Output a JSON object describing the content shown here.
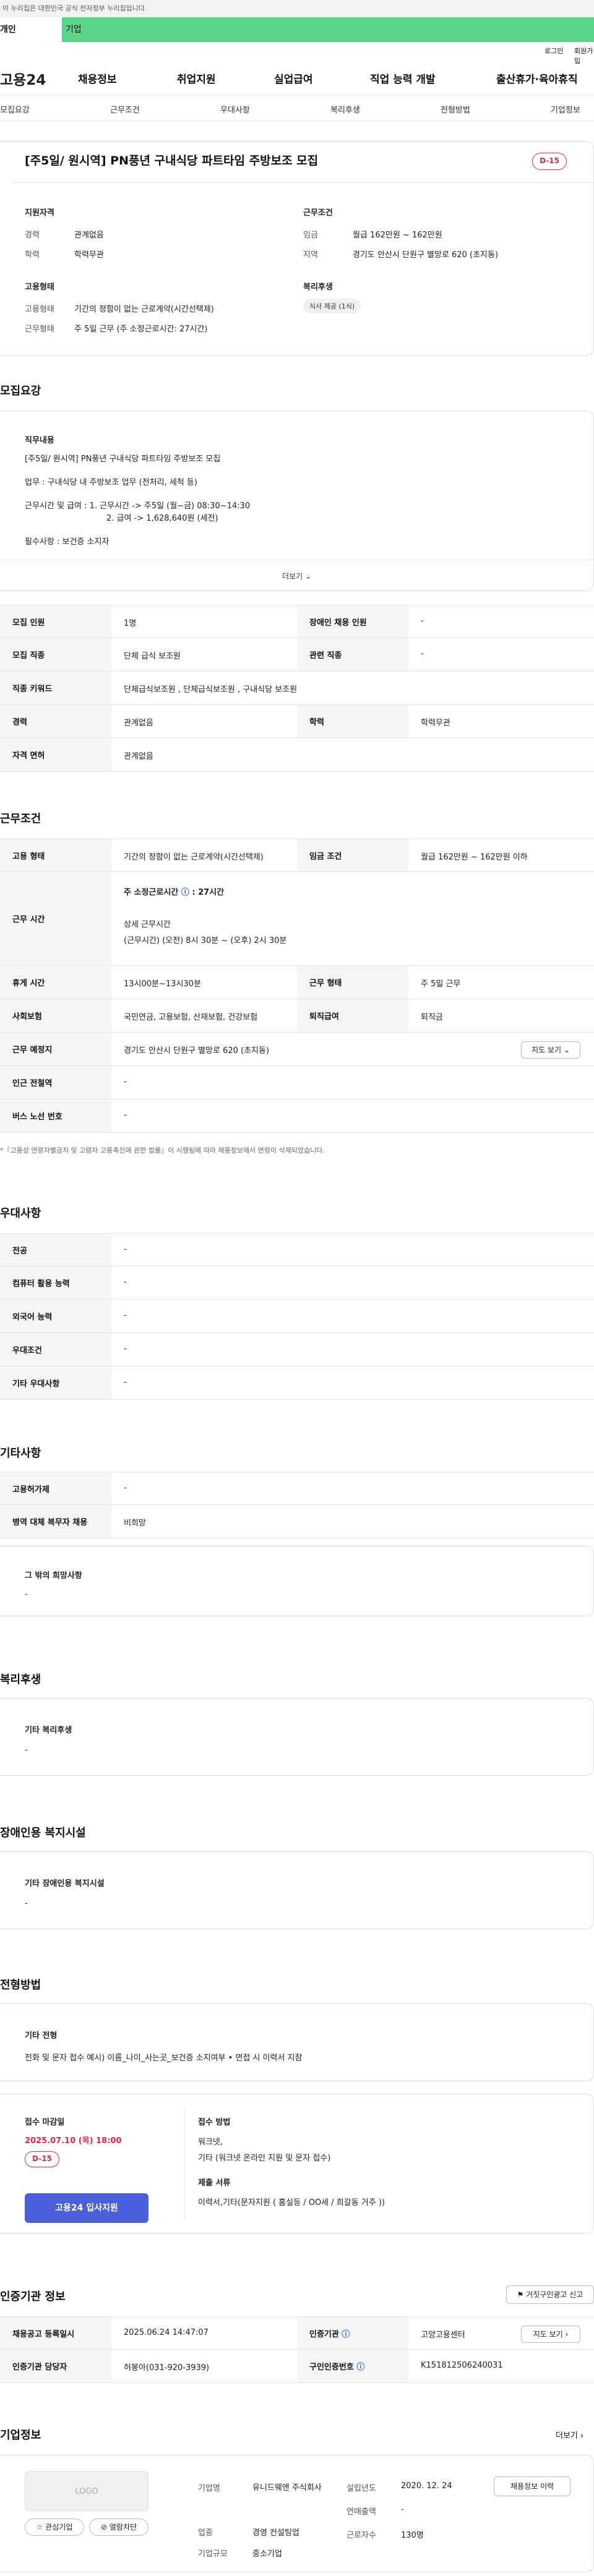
{
  "gov_banner": "이 누리집은 대한민국 공식 전자정부 누리집입니다.",
  "audience": {
    "personal": "개인",
    "company": "기업"
  },
  "util": {
    "login": "로그인",
    "join": "회원가입"
  },
  "logo": "고용24",
  "gnb": [
    "채용정보",
    "취업지원",
    "실업급여",
    "직업 능력 개발",
    "출산휴가·육아휴직"
  ],
  "subnav": [
    "모집요강",
    "근무조건",
    "우대사항",
    "복리후생",
    "전형방법",
    "기업정보"
  ],
  "job": {
    "title": "[주5일/ 원시역] PN풍년 구내식당 파트타임 주방보조 모집",
    "dday": "D-15"
  },
  "summary": {
    "qual_h": "지원자격",
    "exp_l": "경력",
    "exp_v": "관계없음",
    "edu_l": "학력",
    "edu_v": "학력무관",
    "cond_h": "근무조건",
    "wage_l": "임금",
    "wage_v": "월급 162만원 ~ 162만원",
    "loc_l": "지역",
    "loc_v": "경기도 안산시 단원구 별망로 620 (초지동)",
    "emp_h": "고용형태",
    "type_l": "고용형태",
    "type_v": "기간의 정함이 없는 근로계약(시간선택제)",
    "work_l": "근무형태",
    "work_v": "주 5일 근무 (주 소정근로시간: 27시간)",
    "wel_h": "복리후생",
    "wel_chip": "식사 제공 (1식)"
  },
  "recruit": {
    "h": "모집요강",
    "desc_h": "직무내용",
    "lines": [
      "[주5일/ 원시역] PN풍년 구내식당 파트타임 주방보조 모집",
      "업무 : 구내식당 내 주방보조 업무 (전처리, 세척 등)",
      "근무시간 및 급여 :   1. 근무시간 -> 주5일 (월~금) 08:30~14:30",
      "2. 급여 -> 1,628,640원 (세전)",
      "필수사항 : 보건증 소지자"
    ],
    "more": "더보기",
    "rows": [
      {
        "a": "모집 인원",
        "b": "1명",
        "c": "장애인 채용 인원",
        "d": "-"
      },
      {
        "a": "모집 직종",
        "b": "단체 급식 보조원",
        "c": "관련 직종",
        "d": "-"
      },
      {
        "a": "직종 키워드",
        "b": "단체급식보조원 , 단체급식보조원 , 구내식당 보조원"
      },
      {
        "a": "경력",
        "b": "관계없음",
        "c": "학력",
        "d": "학력무관"
      },
      {
        "a": "자격 면허",
        "b": "관계없음"
      }
    ]
  },
  "cond": {
    "h": "근무조건",
    "type_a": "고용 형태",
    "type_b": "기간의 정함이 없는 근로계약(시간선택제)",
    "wage_a": "임금 조건",
    "wage_b": "월급 162만원 ~ 162만원 이하",
    "time_a": "근무 시간",
    "time_week": "주 소정근로시간",
    "time_week_v": "27시간",
    "time_detail_h": "상세 근무시간",
    "time_detail_v": "(근무시간) (오전) 8시 30분 ~ (오후) 2시 30분",
    "rest_a": "휴게 시간",
    "rest_b": "13시00분~13시30분",
    "form_a": "근무 형태",
    "form_b": "주 5일 근무",
    "ins_a": "사회보험",
    "ins_b": "국민연금, 고용보험, 산재보험, 건강보험",
    "ret_a": "퇴직급여",
    "ret_b": "퇴직금",
    "place_a": "근무 예정지",
    "place_b": "경기도 안산시 단원구 별망로 620 (초지동)",
    "map_btn": "지도 보기",
    "sub_a": "인근 전철역",
    "sub_b": "-",
    "bus_a": "버스 노선 번호",
    "bus_b": "-",
    "note": "*『고용상 연령차별금지 및 고령자 고용촉진에 관한 법률』이 시행됨에 따라 채용정보에서 연령이 삭제되었습니다."
  },
  "pref": {
    "h": "우대사항",
    "rows": [
      [
        "전공",
        "-"
      ],
      [
        "컴퓨터 활용 능력",
        "-"
      ],
      [
        "외국어 능력",
        "-"
      ],
      [
        "우대조건",
        "-"
      ],
      [
        "기타 우대사항",
        "-"
      ]
    ]
  },
  "etc": {
    "h": "기타사항",
    "rows": [
      [
        "고용허가제",
        "-"
      ],
      [
        "병역 대체 복무자 채용",
        "비희망"
      ]
    ],
    "hope_h": "그 밖의 희망사항",
    "hope_v": "-"
  },
  "welfare": {
    "h": "복리후생",
    "box_h": "기타 복리후생",
    "box_v": "-"
  },
  "disab": {
    "h": "장애인용 복지시설",
    "box_h": "기타 장애인용 복지시설",
    "box_v": "-"
  },
  "select": {
    "h": "전형방법",
    "box_h": "기타 전형",
    "box_v": "전화 및 문자 접수 예시) 이름_나이_사는곳_보건증 소지여부 • 면접 시 이력서 지참",
    "dl_h": "접수 마감일",
    "dl_v": "2025.07.10 (목) 18:00",
    "dday": "D-15",
    "apply_btn": "고용24 입사지원",
    "method_h": "접수 방법",
    "method_v1": "워크넷,",
    "method_v2": "기타 (워크넷 온라인 지원 및 문자 접수)",
    "docs_h": "제출 서류",
    "docs_v": "이력서,기타(문자지원 ( 홈실등 / OO세 / 희갈동 거주 ))"
  },
  "auth": {
    "h": "인증기관 정보",
    "report_btn": "거짓구인광고 신고",
    "reg_a": "채용공고 등록일시",
    "reg_b": "2025.06.24 14:47:07",
    "org_a": "인증기관",
    "org_b": "고양고용센터",
    "map_btn": "지도 보기",
    "mgr_a": "인증기관 담당자",
    "mgr_b": "허봉아(031-920-3939)",
    "no_a": "구인인증번호",
    "no_b": "K151812506240031"
  },
  "company": {
    "h": "기업정보",
    "more": "더보기",
    "logo": "LOGO",
    "fav": "관심기업",
    "block": "열람차단",
    "name_l": "기업명",
    "name_v": "유니드웨앤 주식회사",
    "est_l": "설립년도",
    "est_v": "2020. 12. 24",
    "info_btn": "채용정보 이력",
    "sales_l": "연매출액",
    "sales_v": "-",
    "ind_l": "업종",
    "ind_v": "경영 컨설팅업",
    "emp_l": "근로자수",
    "emp_v": "130명",
    "size_l": "기업규모",
    "size_v": "중소기업"
  },
  "colors": {
    "accent": "#2d5bd7",
    "dday": "#e0284f",
    "company_bar": "#5cd38a",
    "apply": "#4a5fd9"
  }
}
